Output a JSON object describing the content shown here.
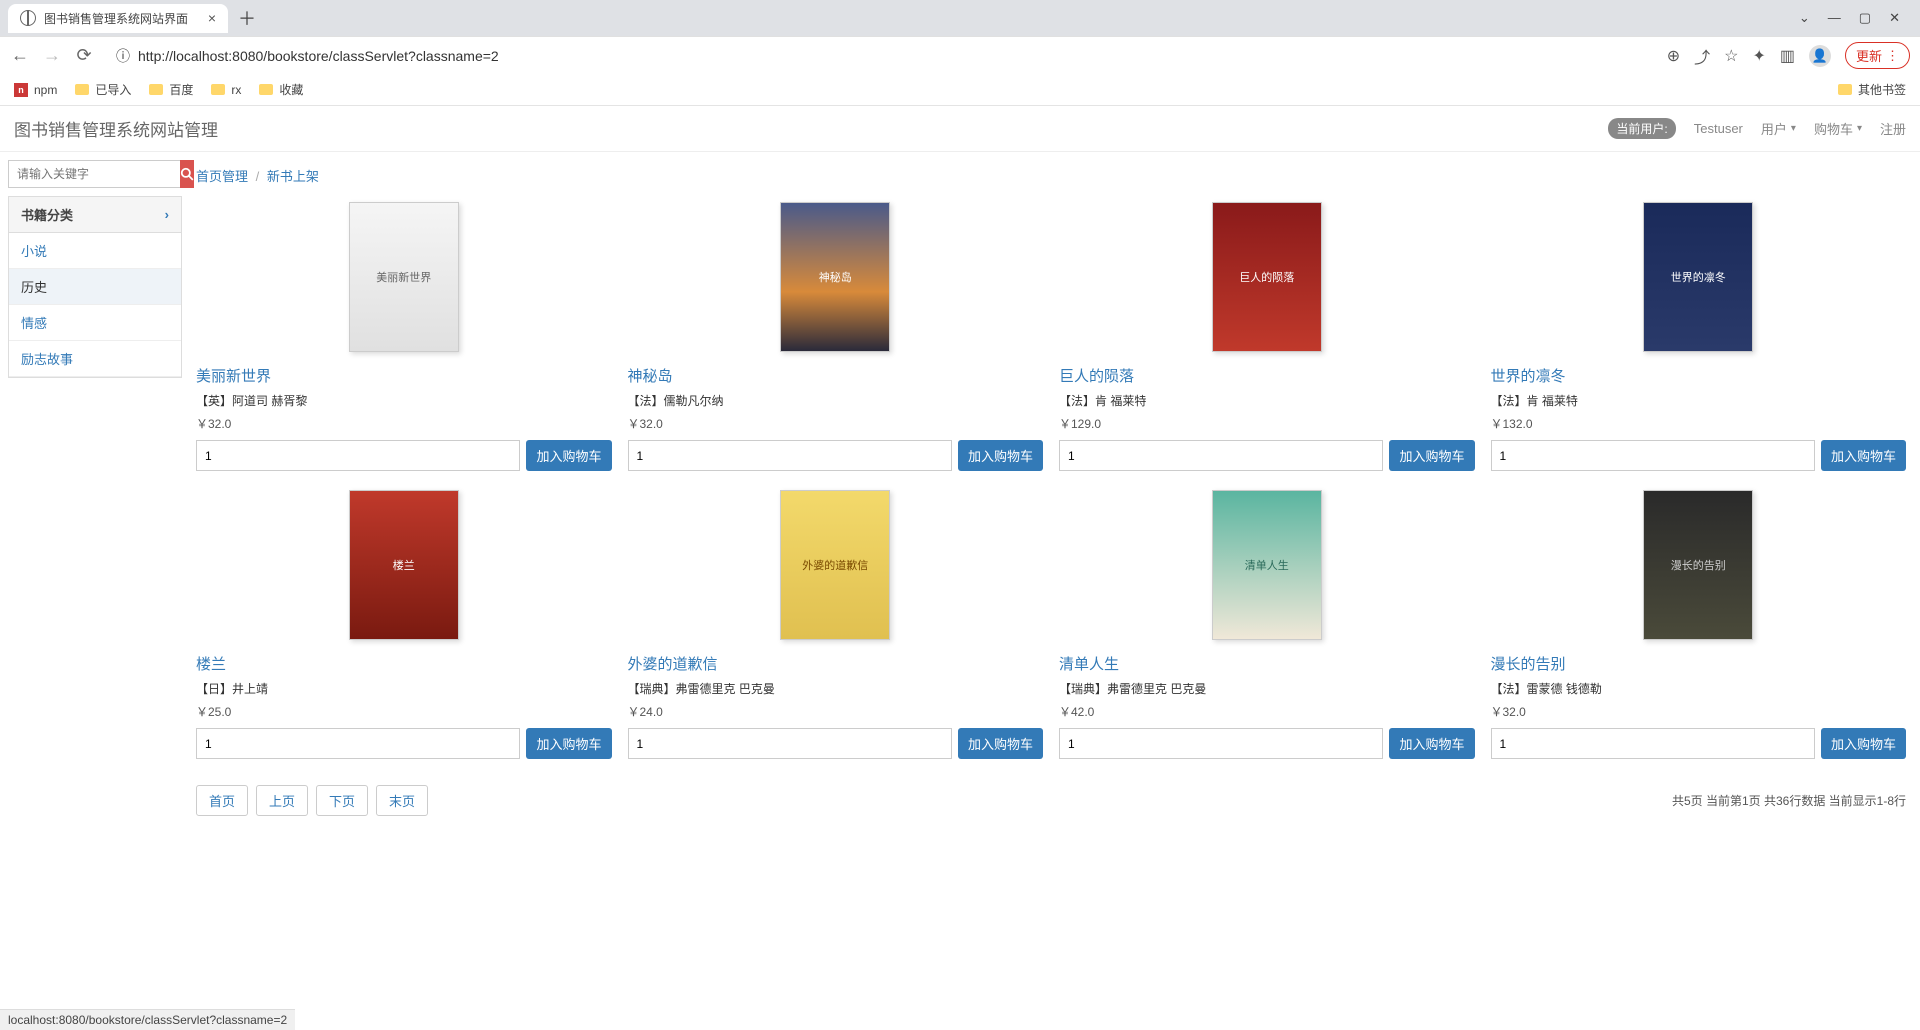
{
  "browser": {
    "tab_title": "图书销售管理系统网站界面",
    "url_display": "http://localhost:8080/bookstore/classServlet?classname=2",
    "update_label": "更新",
    "bookmarks": [
      "npm",
      "已导入",
      "百度",
      "rx",
      "收藏"
    ],
    "other_bookmarks": "其他书签",
    "status_bar": "localhost:8080/bookstore/classServlet?classname=2"
  },
  "header": {
    "title": "图书销售管理系统网站管理",
    "current_user_label": "当前用户:",
    "current_user": "Testuser",
    "menu_user": "用户",
    "menu_cart": "购物车",
    "menu_register": "注册"
  },
  "search": {
    "placeholder": "请输入关键字"
  },
  "sidebar": {
    "header": "书籍分类",
    "items": [
      "小说",
      "历史",
      "情感",
      "励志故事"
    ],
    "active_index": 1
  },
  "breadcrumb": {
    "a": "首页管理",
    "b": "新书上架"
  },
  "products": [
    {
      "title": "美丽新世界",
      "author": "【英】阿道司 赫胥黎",
      "price": "￥32.0",
      "qty": "1"
    },
    {
      "title": "神秘岛",
      "author": "【法】儒勒凡尔纳",
      "price": "￥32.0",
      "qty": "1"
    },
    {
      "title": "巨人的陨落",
      "author": "【法】肯 福莱特",
      "price": "￥129.0",
      "qty": "1"
    },
    {
      "title": "世界的凛冬",
      "author": "【法】肯 福莱特",
      "price": "￥132.0",
      "qty": "1"
    },
    {
      "title": "楼兰",
      "author": "【日】井上靖",
      "price": "￥25.0",
      "qty": "1"
    },
    {
      "title": "外婆的道歉信",
      "author": "【瑞典】弗雷德里克 巴克曼",
      "price": "￥24.0",
      "qty": "1"
    },
    {
      "title": "清单人生",
      "author": "【瑞典】弗雷德里克 巴克曼",
      "price": "￥42.0",
      "qty": "1"
    },
    {
      "title": "漫长的告别",
      "author": "【法】雷蒙德 钱德勒",
      "price": "￥32.0",
      "qty": "1"
    }
  ],
  "add_to_cart_label": "加入购物车",
  "pager": {
    "first": "首页",
    "prev": "上页",
    "next": "下页",
    "last": "末页"
  },
  "pager_info": "共5页 当前第1页 共36行数据 当前显示1-8行"
}
